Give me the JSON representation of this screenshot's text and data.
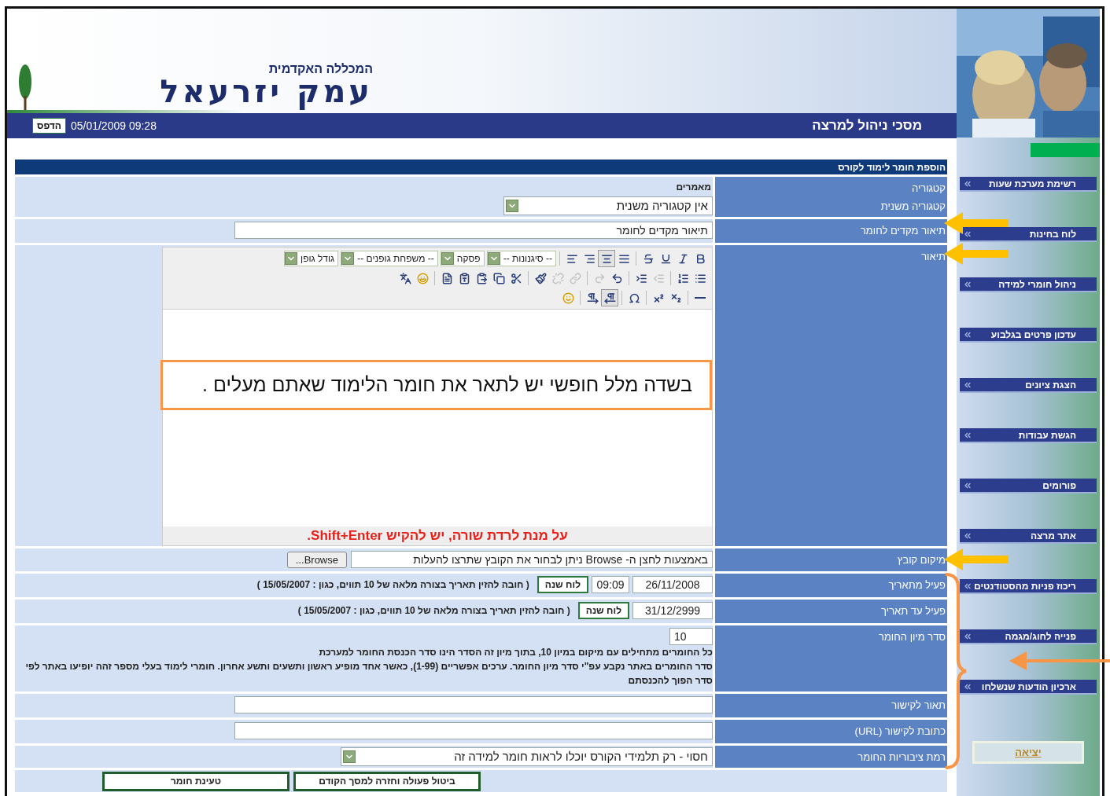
{
  "header": {
    "college_subtitle": "המכללה האקדמית",
    "college_name": "עמק יזרעאל",
    "screen_title": "מסכי ניהול למרצה",
    "datetime": "05/01/2009 09:28",
    "print_button": "הדפס"
  },
  "sidebar": {
    "items": [
      {
        "label": "רשימת מערכת שעות"
      },
      {
        "label": "לוח בחינות"
      },
      {
        "label": "ניהול חומרי למידה"
      },
      {
        "label": "עדכון פרטים בגלבוע"
      },
      {
        "label": "הצגת ציונים"
      },
      {
        "label": "הגשת עבודות"
      },
      {
        "label": "פורומים"
      },
      {
        "label": "אתר מרצה"
      },
      {
        "label": "ריכוז פניות מהסטודנטים"
      },
      {
        "label": "פנייה לחוג/מגמה"
      },
      {
        "label": "ארכיון הודעות שנשלחו"
      }
    ],
    "exit": "יציאה"
  },
  "form": {
    "title": "הוספת חומר לימוד לקורס",
    "rows": [
      {
        "kind": "static",
        "label": "קטגוריה",
        "value": "מאמרים"
      },
      {
        "kind": "select",
        "label": "קטגוריה משנית",
        "value": "אין קטגוריה משנית"
      },
      {
        "kind": "text",
        "label": "תיאור מקדים לחומר",
        "value": "תיאור מקדים לחומר"
      },
      {
        "kind": "editor",
        "label": "תיאור",
        "toolbar_rows": [
          {
            "groups": [
              [
                {
                  "kind": "bold",
                  "pressed": false,
                  "disabled": false
                },
                {
                  "kind": "italic",
                  "pressed": false,
                  "disabled": false
                },
                {
                  "kind": "underline",
                  "pressed": false,
                  "disabled": false
                },
                {
                  "kind": "strike",
                  "pressed": false,
                  "disabled": false
                }
              ],
              [
                {
                  "kind": "align-justify",
                  "pressed": false,
                  "disabled": false
                },
                {
                  "kind": "align-center",
                  "pressed": true,
                  "disabled": false
                },
                {
                  "kind": "align-right",
                  "pressed": false,
                  "disabled": false
                },
                {
                  "kind": "align-left",
                  "pressed": false,
                  "disabled": false
                }
              ]
            ],
            "dropdowns": [
              "-- סיגנונות --",
              "פסקה",
              "-- משפחת גופנים --",
              "גודל גופן"
            ]
          },
          {
            "groups": [
              [
                {
                  "kind": "bullet-list",
                  "pressed": false,
                  "disabled": false
                },
                {
                  "kind": "numbered-list",
                  "pressed": false,
                  "disabled": false
                }
              ],
              [
                {
                  "kind": "outdent",
                  "pressed": false,
                  "disabled": true
                },
                {
                  "kind": "indent",
                  "pressed": false,
                  "disabled": false
                }
              ],
              [
                {
                  "kind": "undo",
                  "pressed": false,
                  "disabled": false
                },
                {
                  "kind": "redo",
                  "pressed": false,
                  "disabled": true
                }
              ],
              [
                {
                  "kind": "link",
                  "pressed": false,
                  "disabled": true
                },
                {
                  "kind": "anchor",
                  "pressed": false,
                  "disabled": true
                },
                {
                  "kind": "brush",
                  "pressed": false,
                  "disabled": false
                }
              ],
              [
                {
                  "kind": "cut",
                  "pressed": false,
                  "disabled": false
                },
                {
                  "kind": "copy",
                  "pressed": false,
                  "disabled": false
                },
                {
                  "kind": "paste",
                  "pressed": false,
                  "disabled": false
                },
                {
                  "kind": "paste-text",
                  "pressed": false,
                  "disabled": false
                },
                {
                  "kind": "paste-word",
                  "pressed": false,
                  "disabled": false
                }
              ],
              [
                {
                  "kind": "emoji",
                  "pressed": false,
                  "disabled": false
                },
                {
                  "kind": "spellcheck",
                  "pressed": false,
                  "disabled": false
                }
              ]
            ]
          },
          {
            "groups": [
              [
                {
                  "kind": "rule",
                  "pressed": false,
                  "disabled": false
                }
              ],
              [
                {
                  "kind": "subscript",
                  "pressed": false,
                  "disabled": false
                },
                {
                  "kind": "superscript",
                  "pressed": false,
                  "disabled": false
                }
              ],
              [
                {
                  "kind": "omega",
                  "pressed": false,
                  "disabled": false
                }
              ],
              [
                {
                  "kind": "pilcrow-rtl",
                  "pressed": true,
                  "disabled": false
                },
                {
                  "kind": "pilcrow-ltr",
                  "pressed": false,
                  "disabled": false
                }
              ],
              [
                {
                  "kind": "smiley",
                  "pressed": false,
                  "disabled": false
                }
              ]
            ]
          }
        ],
        "callout": "בשדה מלל חופשי יש לתאר את חומר הלימוד שאתם מעלים .",
        "hint": "על מנת לרדת שורה, יש להקיש Shift+Enter."
      },
      {
        "kind": "file",
        "label": "מיקום קובץ",
        "value": "באמצעות לחצן ה- Browse  ניתן לבחור את הקובץ שתרצו להעלות",
        "button": "Browse..."
      },
      {
        "kind": "datetime",
        "label": "פעיל מתאריך",
        "date": "26/11/2008",
        "time": "09:09",
        "button": "לוח שנה",
        "note": "( חובה להזין תאריך בצורה מלאה של 10 תווים, כגון : 15/05/2007 )"
      },
      {
        "kind": "date",
        "label": "פעיל עד תאריך",
        "date": "31/12/2999",
        "button": "לוח שנה",
        "note": "( חובה להזין תאריך בצורה מלאה של 10 תווים, כגון : 15/05/2007 )"
      },
      {
        "kind": "sort",
        "label": "סדר מיון החומר",
        "value": "10",
        "notes": [
          "כל החומרים מתחילים עם מיקום במיון 10, בתוך מיון זה הסדר הינו סדר הכנסת החומר למערכת",
          "סדר החומרים באתר נקבע עפ\"י סדר מיון החומר. ערכים אפשריים (1-99), כאשר אחד מופיע ראשון ותשעים ותשע אחרון. חומרי לימוד בעלי מספר זהה יופיעו באתר לפי סדר הפוך להכנסתם"
        ]
      },
      {
        "kind": "text",
        "label": "תאור לקישור"
      },
      {
        "kind": "text",
        "label": "כתובת לקישור (URL)"
      },
      {
        "kind": "select",
        "label": "רמת ציבוריות החומר",
        "value": "חסוי - רק תלמידי הקורס יוכלו לראות חומר למידה זה"
      }
    ],
    "buttons": [
      "ביטול פעולה וחזרה למסך הקודם",
      "טעינת חומר"
    ]
  }
}
